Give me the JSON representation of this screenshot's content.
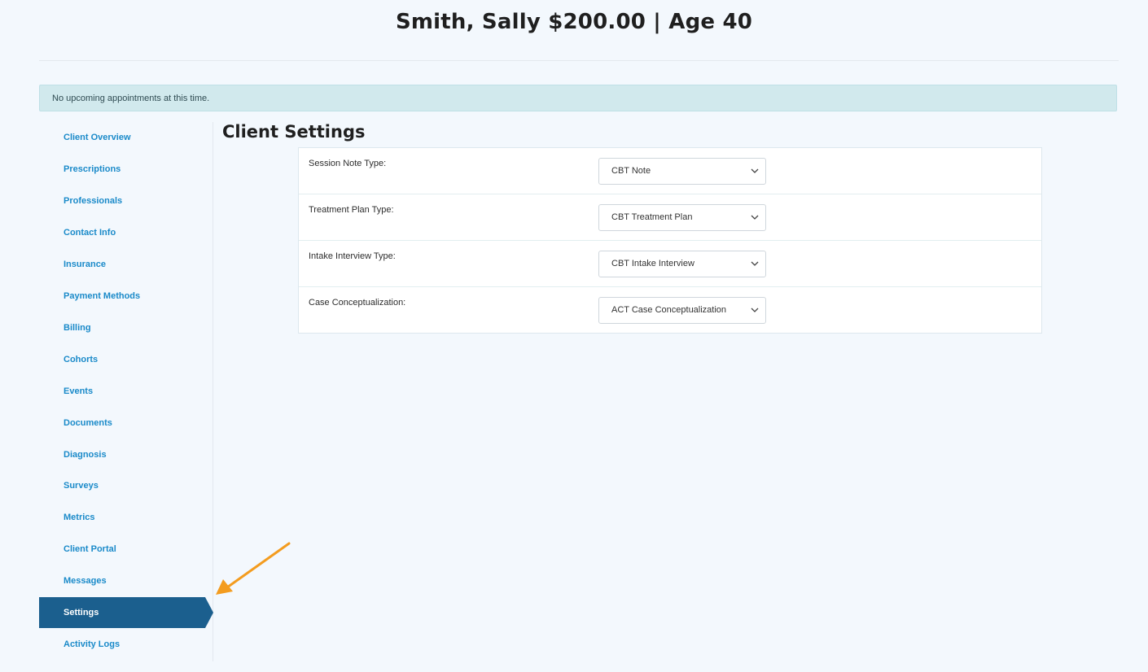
{
  "header": {
    "title": "Smith, Sally $200.00 | Age 40"
  },
  "alert": {
    "text": "No upcoming appointments at this time."
  },
  "sidebar": {
    "items": [
      {
        "label": "Client Overview",
        "active": false
      },
      {
        "label": "Prescriptions",
        "active": false
      },
      {
        "label": "Professionals",
        "active": false
      },
      {
        "label": "Contact Info",
        "active": false
      },
      {
        "label": "Insurance",
        "active": false
      },
      {
        "label": "Payment Methods",
        "active": false
      },
      {
        "label": "Billing",
        "active": false
      },
      {
        "label": "Cohorts",
        "active": false
      },
      {
        "label": "Events",
        "active": false
      },
      {
        "label": "Documents",
        "active": false
      },
      {
        "label": "Diagnosis",
        "active": false
      },
      {
        "label": "Surveys",
        "active": false
      },
      {
        "label": "Metrics",
        "active": false
      },
      {
        "label": "Client Portal",
        "active": false
      },
      {
        "label": "Messages",
        "active": false
      },
      {
        "label": "Settings",
        "active": true
      },
      {
        "label": "Activity Logs",
        "active": false
      }
    ]
  },
  "main": {
    "title": "Client Settings",
    "settings": [
      {
        "label": "Session Note Type:",
        "value": "CBT Note"
      },
      {
        "label": "Treatment Plan Type:",
        "value": "CBT Treatment Plan"
      },
      {
        "label": "Intake Interview Type:",
        "value": "CBT Intake Interview"
      },
      {
        "label": "Case Conceptualization:",
        "value": "ACT Case Conceptualization"
      }
    ]
  },
  "colors": {
    "accent": "#1a8ac9",
    "active_bg": "#1b5f8e",
    "alert_bg": "#d1e9ed",
    "annotation_arrow": "#f39c1f"
  },
  "icons": {
    "select_chevron": "chevron-down-icon",
    "annotation": "arrow-icon"
  }
}
